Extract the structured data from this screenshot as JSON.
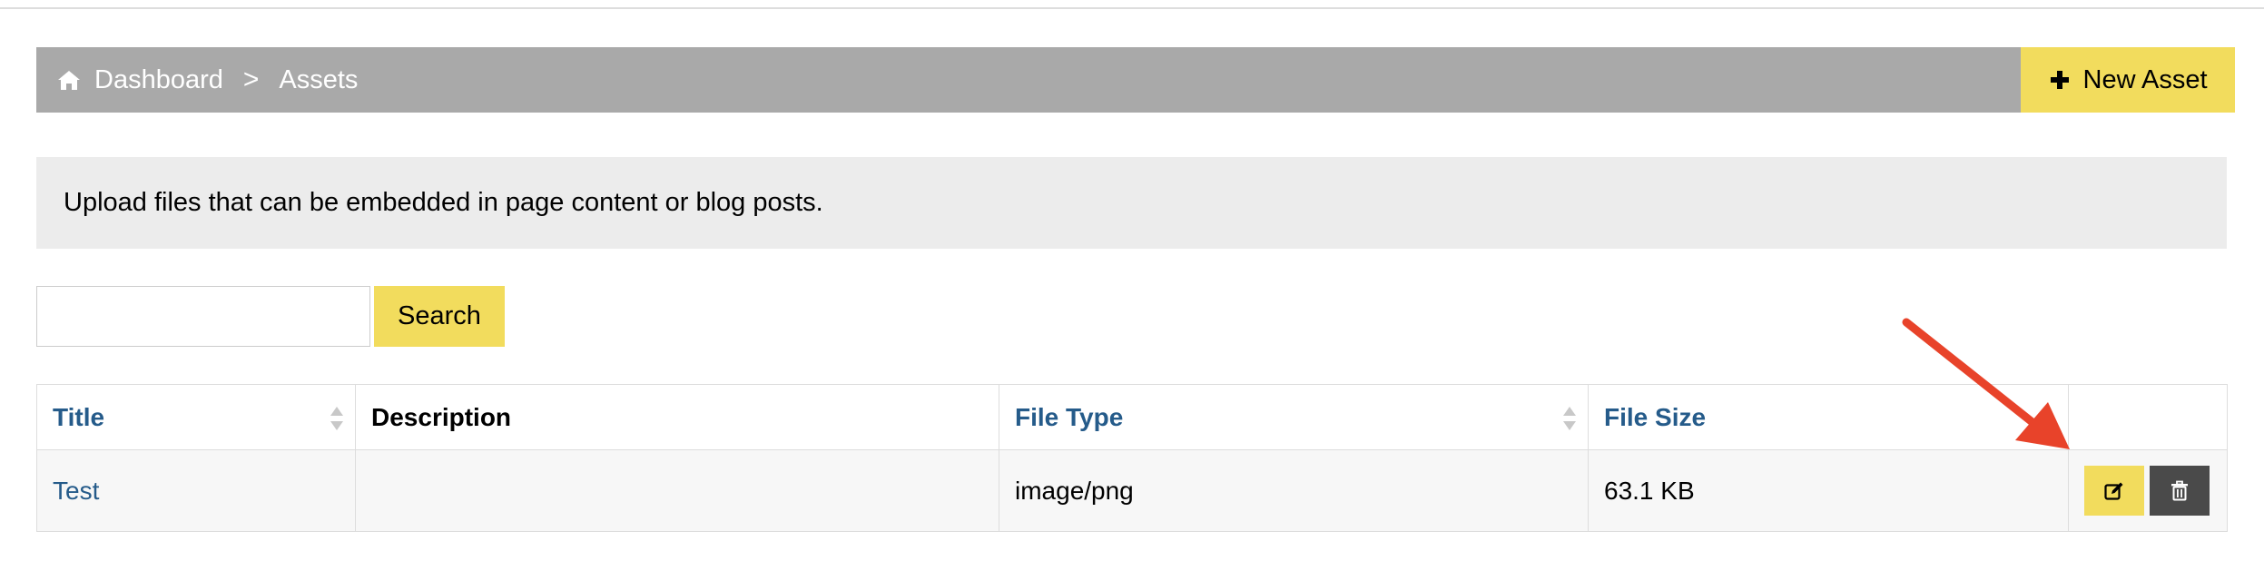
{
  "breadcrumb": {
    "home_icon": "home-icon",
    "items": [
      "Dashboard",
      "Assets"
    ],
    "separator": ">"
  },
  "new_asset_button": {
    "icon": "plus-icon",
    "label": "New Asset"
  },
  "notice": "Upload files that can be embedded in page content or blog posts.",
  "search": {
    "value": "",
    "placeholder": "",
    "button_label": "Search"
  },
  "table": {
    "columns": [
      "Title",
      "Description",
      "File Type",
      "File Size",
      ""
    ],
    "rows": [
      {
        "title": "Test",
        "description": "",
        "file_type": "image/png",
        "file_size": "63.1 KB"
      }
    ]
  },
  "colors": {
    "accent_yellow": "#f2dc5d",
    "breadcrumb_gray": "#a9a9a9",
    "link_blue": "#255b8a",
    "annotation_arrow": "#e8432a"
  }
}
